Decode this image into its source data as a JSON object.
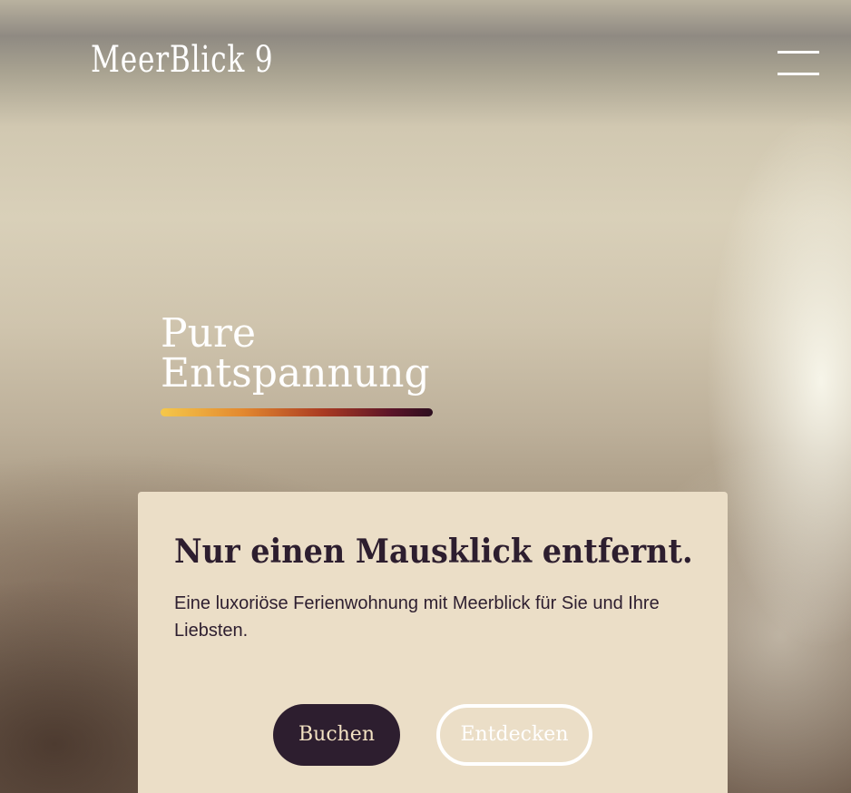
{
  "header": {
    "brand": "MeerBlick 9",
    "menu_icon": "hamburger-menu-icon"
  },
  "hero": {
    "title_line1": "Pure",
    "title_line2": "Entspannung"
  },
  "card": {
    "title": "Nur einen Mausklick entfernt.",
    "text": "Eine luxoriöse Ferienwohnung mit Meerblick für Sie und Ihre Liebsten.",
    "primary_button": "Buchen",
    "secondary_button": "Entdecken"
  },
  "colors": {
    "dark_purple": "#2d1e2f",
    "card_bg": "#ebdec7",
    "gradient": [
      "#f5c84a",
      "#e3892f",
      "#a93a22",
      "#5a1428",
      "#2d0f1f"
    ]
  }
}
